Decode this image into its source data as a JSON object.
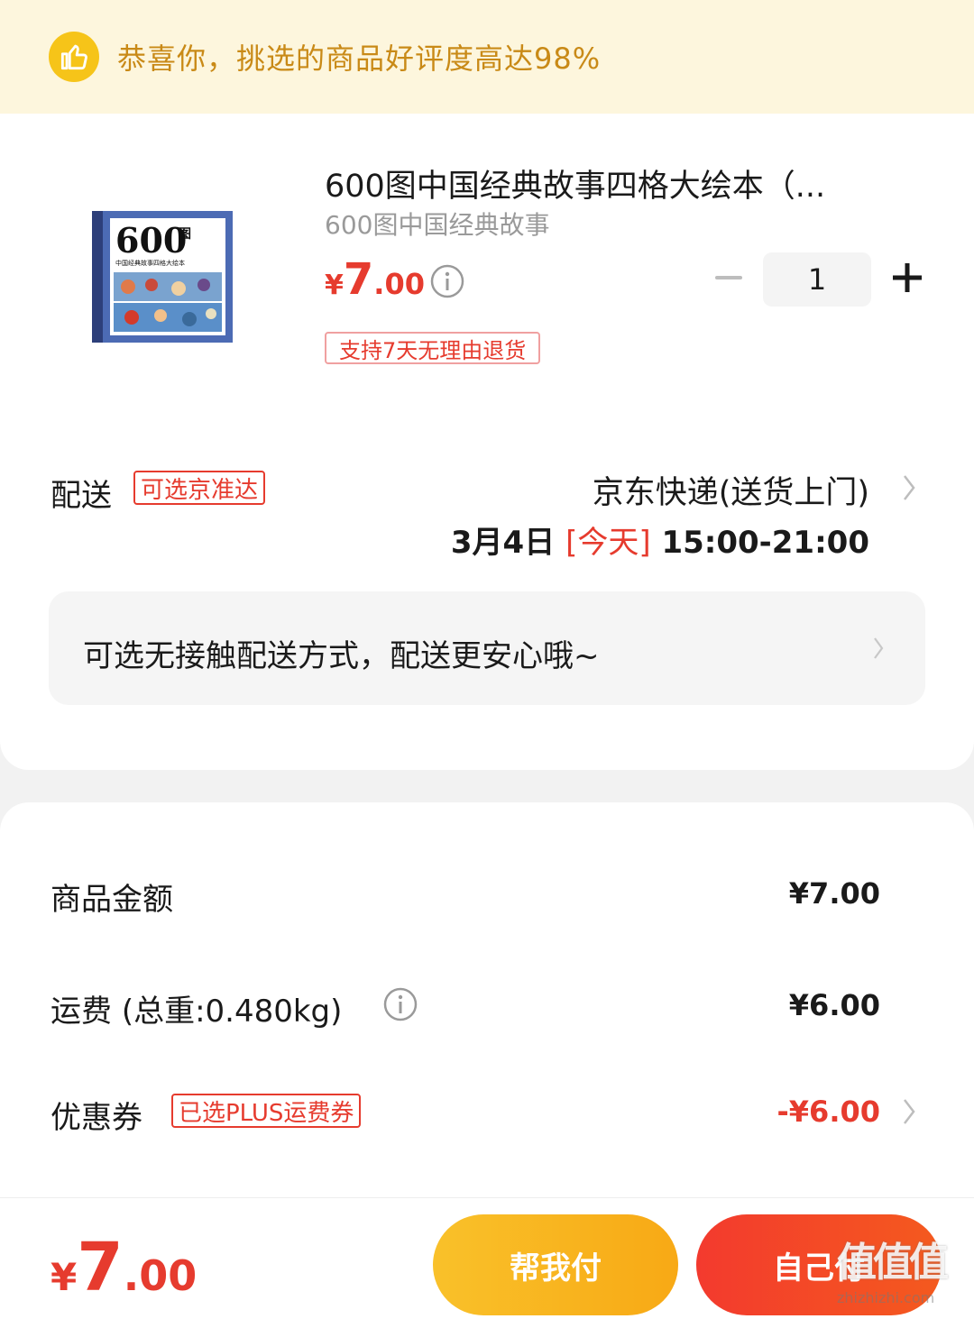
{
  "banner": {
    "text": "恭喜你，挑选的商品好评度高达98%",
    "icon": "thumbs-up-icon",
    "color": "#f6c419"
  },
  "product": {
    "title": "600图中国经典故事四格大绘本（...",
    "subtitle": "600图中国经典故事",
    "price_currency": "¥",
    "price_int": "7",
    "price_dec": ".00",
    "quantity": "1",
    "return_policy": "支持7天无理由退货",
    "cover": {
      "big_title": "600",
      "big_title_suffix": "图",
      "cover_subtitle": "中国经典故事四格大绘本"
    }
  },
  "delivery": {
    "label": "配送",
    "tag": "可选京准达",
    "method": "京东快递(送货上门)",
    "date": "3月4日",
    "today": "[今天]",
    "time_range": "15:00-21:00",
    "contactless": "可选无接触配送方式，配送更安心哦~"
  },
  "summary": {
    "goods_label": "商品金额",
    "goods_value": "¥7.00",
    "shipping_label": "运费",
    "shipping_weight": "(总重:0.480kg)",
    "shipping_value": "¥6.00",
    "coupon_label": "优惠券",
    "coupon_tag": "已选PLUS运费券",
    "coupon_value": "-¥6.00"
  },
  "footer": {
    "total_currency": "¥",
    "total_int": "7",
    "total_dec": ".00",
    "help_pay": "帮我付",
    "self_pay": "自己付"
  },
  "watermark": {
    "logo": "值值值",
    "url": "zhizhizhi.com"
  },
  "colors": {
    "accent_red": "#e63b2e",
    "accent_yellow": "#f8b31f",
    "banner_bg": "#fdf6dd",
    "banner_text": "#c98a17"
  }
}
